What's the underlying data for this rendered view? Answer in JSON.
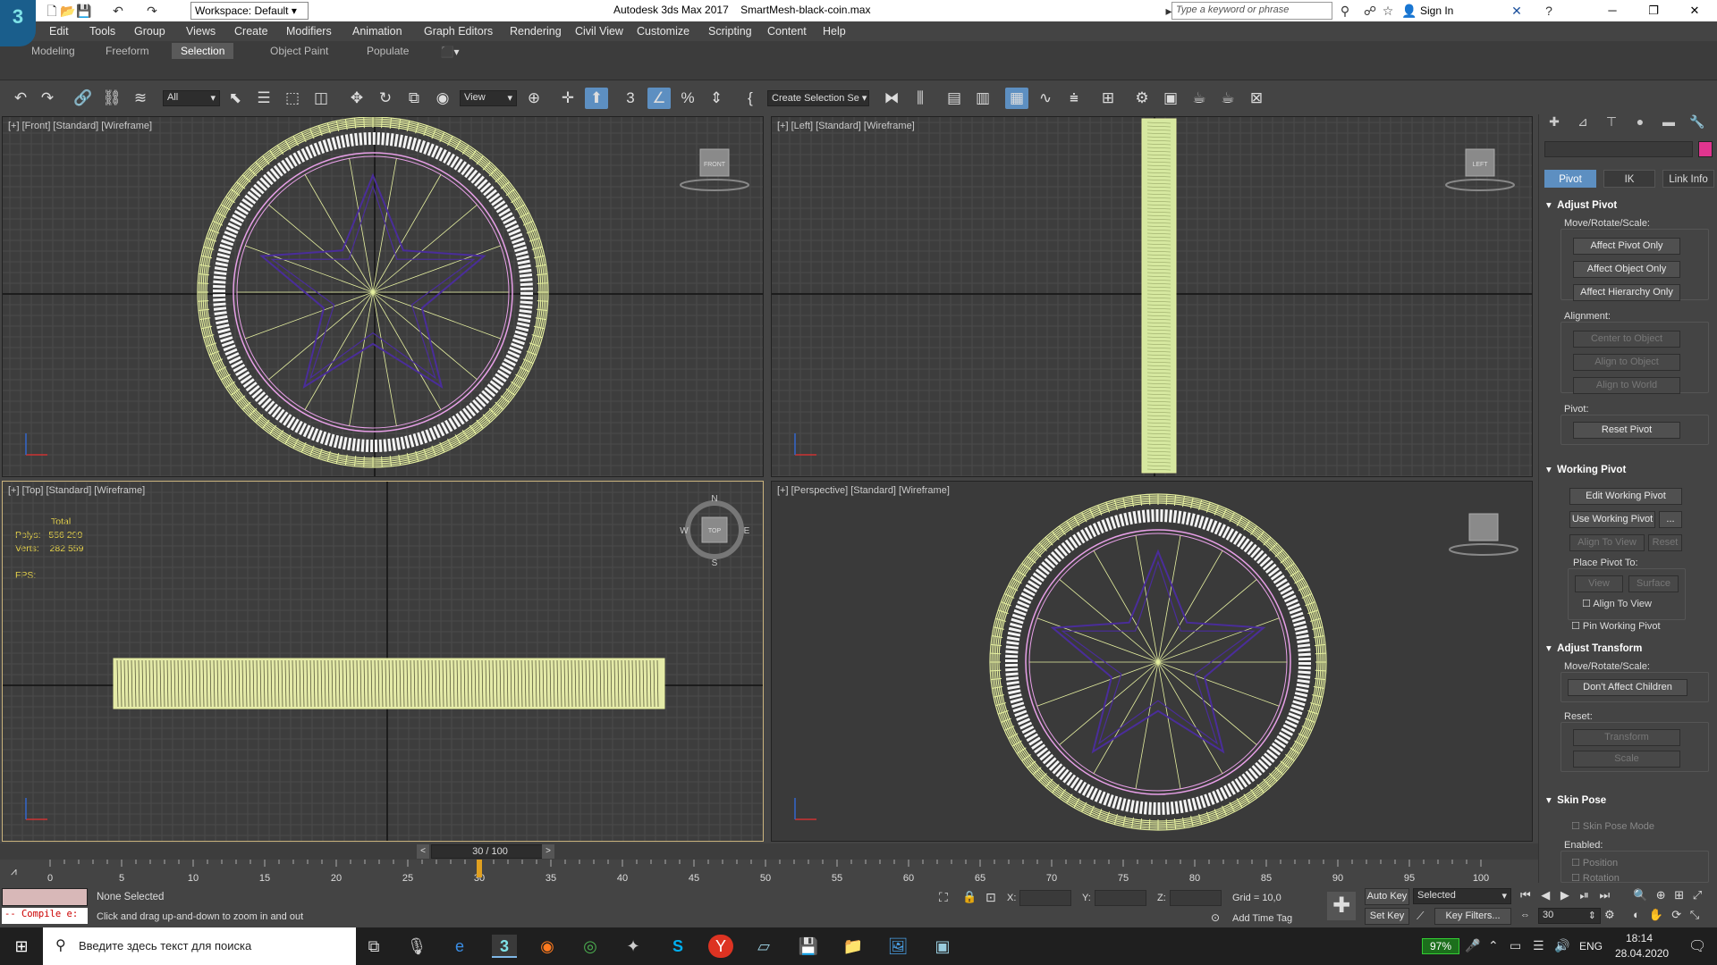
{
  "window": {
    "app_title": "Autodesk 3ds Max 2017",
    "file_name": "SmartMesh-black-coin.max",
    "workspace": "Workspace: Default",
    "search_placeholder": "Type a keyword or phrase",
    "sign_in": "Sign In",
    "logo": "3"
  },
  "menus": [
    "Edit",
    "Tools",
    "Group",
    "Views",
    "Create",
    "Modifiers",
    "Animation",
    "Graph Editors",
    "Rendering",
    "Civil View",
    "Customize",
    "Scripting",
    "Content",
    "Help"
  ],
  "ribbon_tabs": [
    {
      "label": "Modeling",
      "active": false
    },
    {
      "label": "Freeform",
      "active": false
    },
    {
      "label": "Selection",
      "active": true
    },
    {
      "label": "Object Paint",
      "active": false
    },
    {
      "label": "Populate",
      "active": false
    }
  ],
  "toolbar": {
    "filter": "All",
    "ref_coord": "View",
    "named_selection": "Create Selection Se",
    "snap_number": "3"
  },
  "viewports": {
    "front": "[+] [Front] [Standard] [Wireframe]",
    "left": "[+] [Left] [Standard] [Wireframe]",
    "top": "[+] [Top] [Standard] [Wireframe]",
    "perspective": "[+] [Perspective] [Standard] [Wireframe]",
    "cube_labels": {
      "front": "FRONT",
      "left": "LEFT",
      "top": "TOP"
    },
    "compass": {
      "n": "N",
      "s": "S",
      "e": "E",
      "w": "W"
    }
  },
  "stats": {
    "total_label": "Total",
    "polys_label": "Polys:",
    "polys_value": "556 299",
    "verts_label": "Verts:",
    "verts_value": "282 559",
    "fps_label": "FPS:"
  },
  "command_panel": {
    "tabs": [
      "Pivot",
      "IK",
      "Link Info"
    ],
    "active_tab": "Pivot",
    "color_swatch": "#e0358f",
    "adjust_pivot": {
      "title": "Adjust Pivot",
      "move_label": "Move/Rotate/Scale:",
      "affect_pivot": "Affect Pivot Only",
      "affect_object": "Affect Object Only",
      "affect_hierarchy": "Affect Hierarchy Only",
      "alignment_label": "Alignment:",
      "center_to_object": "Center to Object",
      "align_to_object": "Align to Object",
      "align_to_world": "Align to World",
      "pivot_label": "Pivot:",
      "reset_pivot": "Reset Pivot"
    },
    "working_pivot": {
      "title": "Working Pivot",
      "edit": "Edit Working Pivot",
      "use": "Use Working Pivot",
      "more": "...",
      "align_view": "Align To View",
      "reset": "Reset",
      "place_label": "Place Pivot To:",
      "view": "View",
      "surface": "Surface",
      "align_to_view_check": "Align To View",
      "pin": "Pin Working Pivot"
    },
    "adjust_transform": {
      "title": "Adjust Transform",
      "move_label": "Move/Rotate/Scale:",
      "dont_affect": "Don't Affect Children",
      "reset_label": "Reset:",
      "transform": "Transform",
      "scale": "Scale"
    },
    "skin_pose": {
      "title": "Skin Pose",
      "mode": "Skin Pose Mode",
      "enabled_label": "Enabled:",
      "position": "Position",
      "rotation": "Rotation"
    }
  },
  "timeline": {
    "frame_display": "30 / 100",
    "current_frame": 30,
    "total_frames": 100,
    "ticks": [
      "0",
      "5",
      "10",
      "15",
      "20",
      "25",
      "30",
      "35",
      "40",
      "45",
      "50",
      "55",
      "60",
      "65",
      "70",
      "75",
      "80",
      "85",
      "90",
      "95",
      "100"
    ]
  },
  "status": {
    "selection": "None Selected",
    "prompt": "Click and drag up-and-down to zoom in and out",
    "maxscript": "-- Compile e:",
    "x_label": "X:",
    "y_label": "Y:",
    "z_label": "Z:",
    "grid": "Grid = 10,0",
    "add_time_tag": "Add Time Tag",
    "auto_key": "Auto Key",
    "set_key": "Set Key",
    "key_mode": "Selected",
    "key_filters": "Key Filters...",
    "frame_field": "30"
  },
  "taskbar": {
    "search_placeholder": "Введите здесь текст для поиска",
    "battery": "97%",
    "language": "ENG",
    "time": "18:14",
    "date": "28.04.2020"
  },
  "colors": {
    "wire_yellow": "#e6f0a0",
    "wire_purple": "#4a2d9a",
    "wire_pink": "#e8a0e8",
    "accent_blue": "#5d8fc1",
    "stats_yellow": "#e6d24a"
  }
}
